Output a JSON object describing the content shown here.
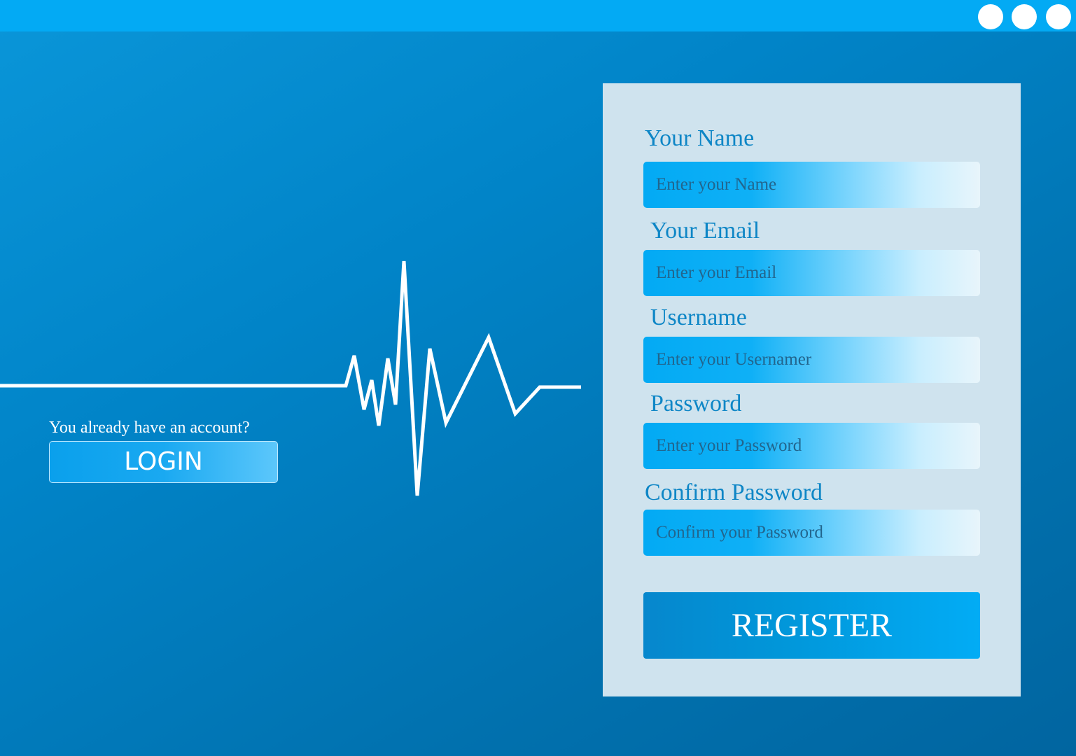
{
  "window": {
    "controls": [
      "window-dot-1",
      "window-dot-2",
      "window-dot-3"
    ]
  },
  "login_section": {
    "question": "You already have an account?",
    "login_label": "LOGIN"
  },
  "form": {
    "name_label": "Your Name",
    "name_placeholder": "Enter your Name",
    "email_label": "Your Email",
    "email_placeholder": "Enter your Email",
    "username_label": "Username",
    "username_placeholder": "Enter your Usernamer",
    "password_label": "Password",
    "password_placeholder": "Enter your Password",
    "confirm_label": "Confirm Password",
    "confirm_placeholder": "Confirm your Password",
    "register_label": "REGISTER"
  },
  "colors": {
    "topbar": "#03aaf4",
    "panel": "#cfe3ee",
    "label": "#0e86c6",
    "accent": "#02acf5"
  }
}
